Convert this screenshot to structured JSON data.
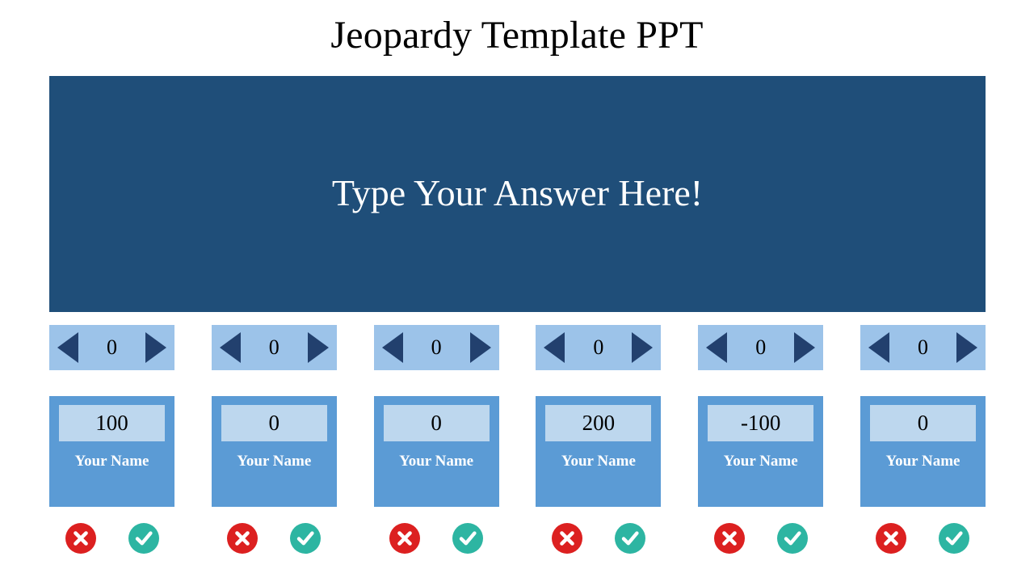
{
  "slide": {
    "title": "Jeopardy Template PPT",
    "answer_prompt": "Type Your Answer Here!",
    "colors": {
      "panel_dark_blue": "#1f4e79",
      "card_blue": "#5b9bd5",
      "spinner_blue": "#9cc3e9",
      "score_box_blue": "#bdd7ee",
      "arrow_navy": "#22406e",
      "wrong_red": "#dc2020",
      "correct_teal": "#2db5a2",
      "title_black": "#000000",
      "text_white": "#ffffff"
    }
  },
  "players": [
    {
      "spinner_value": "0",
      "score": "100",
      "name": "Your Name",
      "wrong_label": "✖",
      "correct_label": "✔"
    },
    {
      "spinner_value": "0",
      "score": "0",
      "name": "Your Name",
      "wrong_label": "✖",
      "correct_label": "✔"
    },
    {
      "spinner_value": "0",
      "score": "0",
      "name": "Your Name",
      "wrong_label": "✖",
      "correct_label": "✔"
    },
    {
      "spinner_value": "0",
      "score": "200",
      "name": "Your Name",
      "wrong_label": "✖",
      "correct_label": "✔"
    },
    {
      "spinner_value": "0",
      "score": "-100",
      "name": "Your Name",
      "wrong_label": "✖",
      "correct_label": "✔"
    },
    {
      "spinner_value": "0",
      "score": "0",
      "name": "Your Name",
      "wrong_label": "✖",
      "correct_label": "✔"
    }
  ]
}
